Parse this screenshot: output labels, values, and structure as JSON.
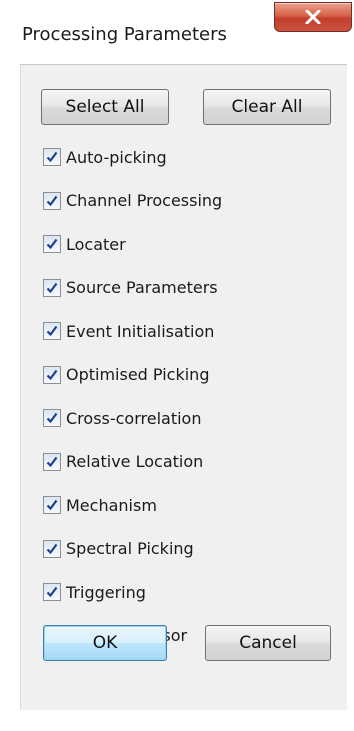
{
  "window": {
    "title": "Processing Parameters"
  },
  "title_bar": {
    "close_glyph": "X"
  },
  "actions": {
    "select_all_label": "Select All",
    "clear_all_label": "Clear All"
  },
  "options": [
    {
      "label": "Auto-picking",
      "checked": true
    },
    {
      "label": "Channel Processing",
      "checked": true
    },
    {
      "label": "Locater",
      "checked": true
    },
    {
      "label": "Source Parameters",
      "checked": true
    },
    {
      "label": "Event Initialisation",
      "checked": true
    },
    {
      "label": "Optimised Picking",
      "checked": true
    },
    {
      "label": "Cross-correlation",
      "checked": true
    },
    {
      "label": "Relative Location",
      "checked": true
    },
    {
      "label": "Mechanism",
      "checked": true
    },
    {
      "label": "Spectral Picking",
      "checked": true
    },
    {
      "label": "Triggering",
      "checked": true
    },
    {
      "label": "Auto-processor",
      "checked": true
    }
  ],
  "footer": {
    "ok_label": "OK",
    "cancel_label": "Cancel"
  },
  "colors": {
    "close_button": "#c9533f",
    "default_button_border": "#3c7fb1",
    "checkmark": "#1f3f8a",
    "dialog_background": "#f0f0f0"
  },
  "icons": {
    "close": "close-icon",
    "check": "checkmark-icon"
  }
}
